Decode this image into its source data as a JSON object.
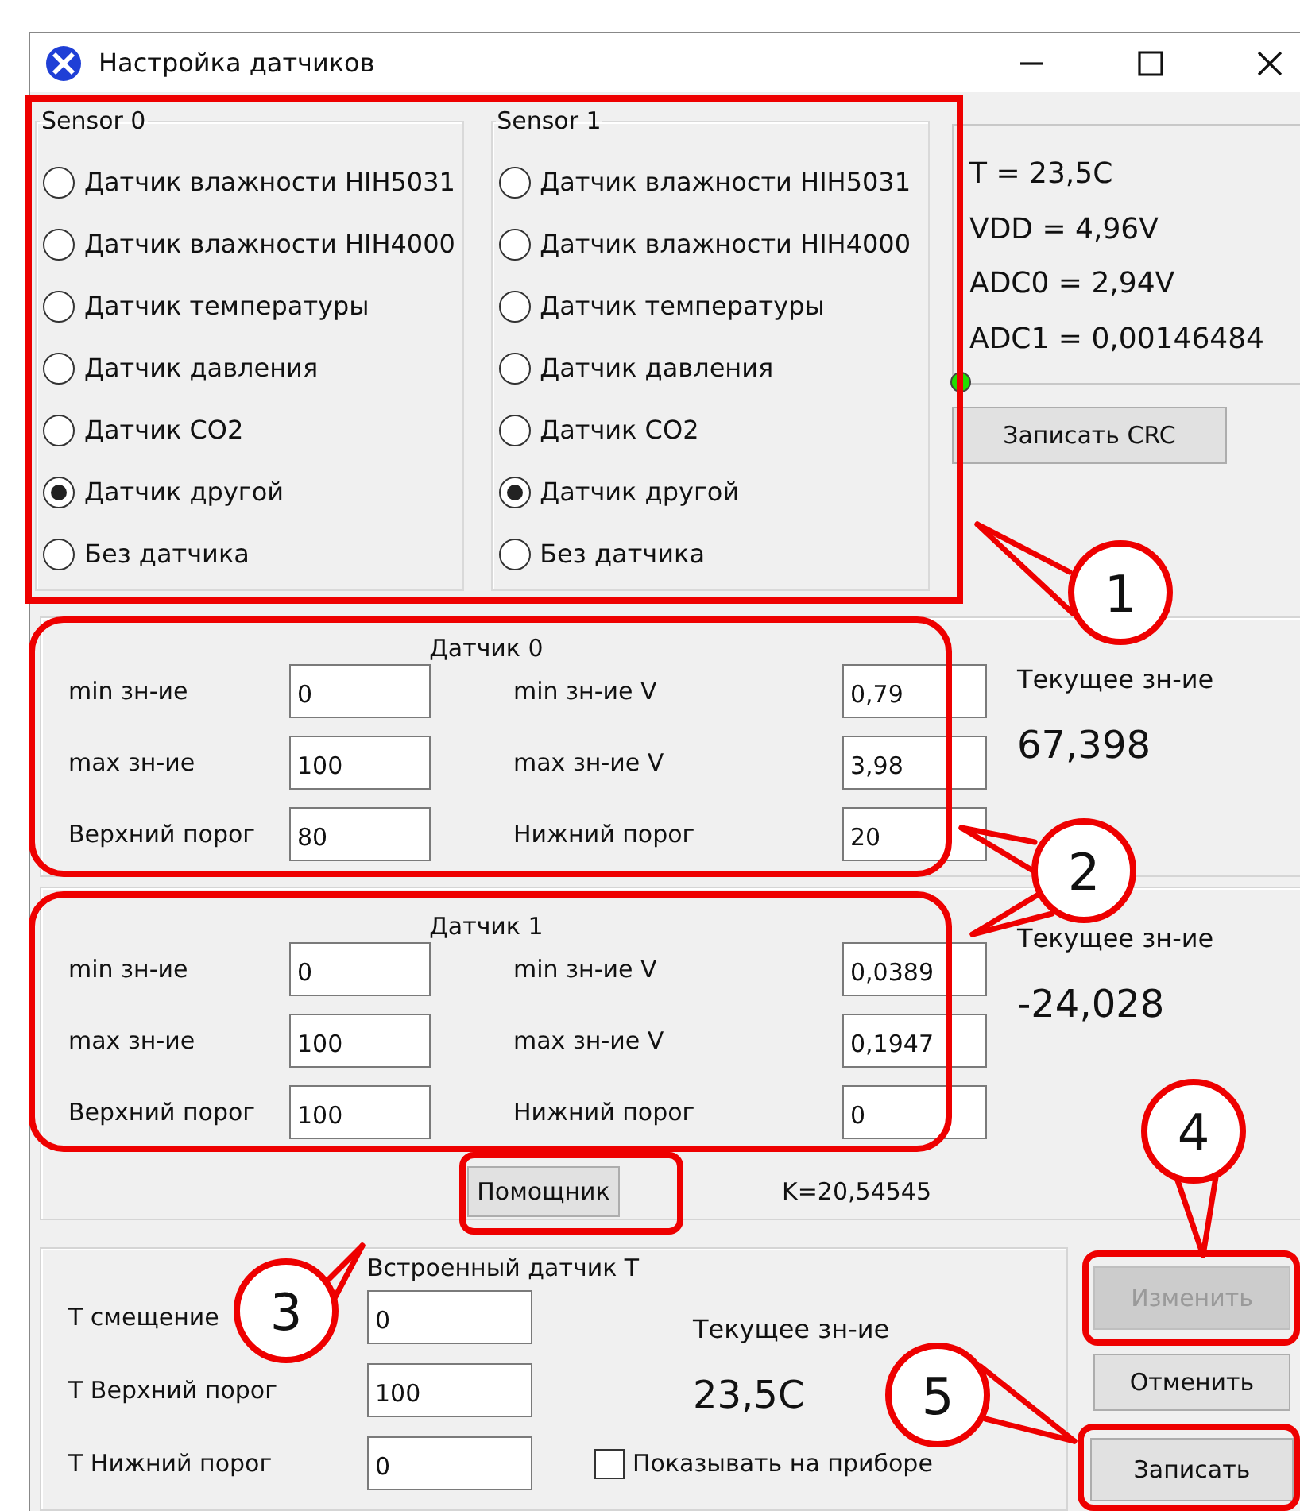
{
  "window": {
    "title": "Настройка датчиков"
  },
  "sensor_groups": [
    {
      "title": "Sensor 0",
      "options": [
        {
          "label": "Датчик влажности HIH5031",
          "selected": false
        },
        {
          "label": "Датчик влажности HIH4000",
          "selected": false
        },
        {
          "label": "Датчик температуры",
          "selected": false
        },
        {
          "label": "Датчик давления",
          "selected": false
        },
        {
          "label": "Датчик CO2",
          "selected": false
        },
        {
          "label": "Датчик другой",
          "selected": true
        },
        {
          "label": "Без датчика",
          "selected": false
        }
      ]
    },
    {
      "title": "Sensor 1",
      "options": [
        {
          "label": "Датчик влажности HIH5031",
          "selected": false
        },
        {
          "label": "Датчик влажности HIH4000",
          "selected": false
        },
        {
          "label": "Датчик температуры",
          "selected": false
        },
        {
          "label": "Датчик давления",
          "selected": false
        },
        {
          "label": "Датчик CO2",
          "selected": false
        },
        {
          "label": "Датчик другой",
          "selected": true
        },
        {
          "label": "Без датчика",
          "selected": false
        }
      ]
    }
  ],
  "readings": [
    "T = 23,5C",
    "VDD = 4,96V",
    "ADC0 = 2,94V",
    "ADC1 = 0,00146484"
  ],
  "crc_button": "Записать CRC",
  "sensor_panels": [
    {
      "title": "Датчик 0",
      "fields": [
        {
          "label": "min зн-ие",
          "value": "0"
        },
        {
          "label": "min зн-ие V",
          "value": "0,79"
        },
        {
          "label": "max зн-ие",
          "value": "100"
        },
        {
          "label": "max зн-ие V",
          "value": "3,98"
        },
        {
          "label": "Верхний порог",
          "value": "80"
        },
        {
          "label": "Нижний порог",
          "value": "20"
        }
      ],
      "current_label": "Текущее зн-ие",
      "current_value": "67,398"
    },
    {
      "title": "Датчик 1",
      "fields": [
        {
          "label": "min зн-ие",
          "value": "0"
        },
        {
          "label": "min зн-ие V",
          "value": "0,0389"
        },
        {
          "label": "max зн-ие",
          "value": "100"
        },
        {
          "label": "max зн-ие V",
          "value": "0,1947"
        },
        {
          "label": "Верхний порог",
          "value": "100"
        },
        {
          "label": "Нижний порог",
          "value": "0"
        }
      ],
      "current_label": "Текущее зн-ие",
      "current_value": "-24,028"
    }
  ],
  "helper_button": "Помощник",
  "k_value": "K=20,54545",
  "builtin": {
    "title": "Встроенный датчик T",
    "fields": [
      {
        "label": "T смещение",
        "value": "0"
      },
      {
        "label": "T Верхний порог",
        "value": "100"
      },
      {
        "label": "T Нижний порог",
        "value": "0"
      }
    ],
    "current_label": "Текущее зн-ие",
    "current_value": "23,5C",
    "checkbox": {
      "label": "Показывать на приборе",
      "checked": false
    }
  },
  "buttons": [
    {
      "label": "Изменить",
      "disabled": true
    },
    {
      "label": "Отменить",
      "disabled": false
    },
    {
      "label": "Записать",
      "disabled": false
    }
  ],
  "annotations": [
    {
      "label": "1"
    },
    {
      "label": "2"
    },
    {
      "label": "3"
    },
    {
      "label": "4"
    },
    {
      "label": "5"
    }
  ]
}
